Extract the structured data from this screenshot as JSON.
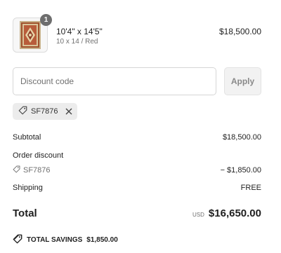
{
  "product": {
    "quantity": "1",
    "name": "10'4\" x 14'5\"",
    "variant": "10 x 14 / Red",
    "price": "$18,500.00"
  },
  "discount": {
    "placeholder": "Discount code",
    "apply_label": "Apply",
    "applied_code": "SF7876"
  },
  "summary": {
    "subtotal_label": "Subtotal",
    "subtotal_value": "$18,500.00",
    "order_discount_label": "Order discount",
    "discount_code": "SF7876",
    "discount_value": "− $1,850.00",
    "shipping_label": "Shipping",
    "shipping_value": "FREE",
    "total_label": "Total",
    "currency": "USD",
    "total_value": "$16,650.00",
    "savings_label": "TOTAL SAVINGS",
    "savings_value": "$1,850.00"
  },
  "icons": {
    "tag": "tag-icon",
    "close": "close-icon",
    "savings": "price-tag-icon"
  }
}
